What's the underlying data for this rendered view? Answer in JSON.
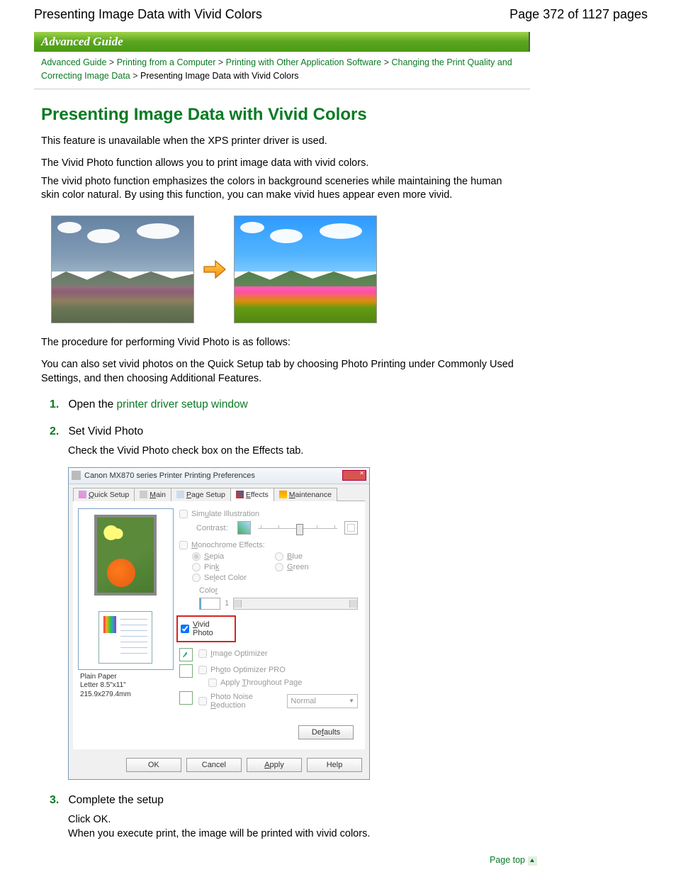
{
  "header": {
    "title": "Presenting Image Data with Vivid Colors",
    "page_indicator": "Page 372 of 1127 pages"
  },
  "banner": "Advanced Guide",
  "breadcrumb": {
    "links": [
      "Advanced Guide",
      "Printing from a Computer",
      "Printing with Other Application Software",
      "Changing the Print Quality and Correcting Image Data"
    ],
    "current": "Presenting Image Data with Vivid Colors",
    "sep": ">"
  },
  "h1": "Presenting Image Data with Vivid Colors",
  "intro": {
    "p1": "This feature is unavailable when the XPS printer driver is used.",
    "p2": "The Vivid Photo function allows you to print image data with vivid colors.",
    "p3": "The vivid photo function emphasizes the colors in background sceneries while maintaining the human skin color natural. By using this function, you can make vivid hues appear even more vivid."
  },
  "procedure_intro": "The procedure for performing Vivid Photo is as follows:",
  "quick_setup_note": "You can also set vivid photos on the Quick Setup tab by choosing Photo Printing under Commonly Used Settings, and then choosing Additional Features.",
  "steps": {
    "s1": {
      "num": "1.",
      "prefix": "Open the ",
      "link": "printer driver setup window"
    },
    "s2": {
      "num": "2.",
      "title": "Set Vivid Photo",
      "body": "Check the Vivid Photo check box on the Effects tab."
    },
    "s3": {
      "num": "3.",
      "title": "Complete the setup",
      "l1": "Click OK.",
      "l2": "When you execute print, the image will be printed with vivid colors."
    }
  },
  "dialog": {
    "title": "Canon MX870 series Printer Printing Preferences",
    "tabs": {
      "quick": "Quick Setup",
      "main": "Main",
      "page": "Page Setup",
      "effects": "Effects",
      "maint": "Maintenance",
      "u_q": "Q",
      "u_m": "M",
      "u_p": "P",
      "u_e": "E",
      "u_mt": "M"
    },
    "left": {
      "media": "Plain Paper",
      "size": "Letter 8.5\"x11\" 215.9x279.4mm"
    },
    "right": {
      "simulate": "Simulate Illustration",
      "contrast": "Contrast:",
      "mono": "Monochrome Effects:",
      "sepia": "Sepia",
      "pink": "Pink",
      "select_color": "Select Color",
      "blue": "Blue",
      "green": "Green",
      "color_lbl": "Color",
      "color_val": "1",
      "vivid": "Vivid Photo",
      "img_opt": "Image Optimizer",
      "photo_pro": "Photo Optimizer PRO",
      "apply_page": "Apply Throughout Page",
      "noise": "Photo Noise Reduction",
      "noise_val": "Normal",
      "defaults": "Defaults"
    },
    "footer": {
      "ok": "OK",
      "cancel": "Cancel",
      "apply": "Apply",
      "help": "Help"
    }
  },
  "pagetop": "Page top"
}
